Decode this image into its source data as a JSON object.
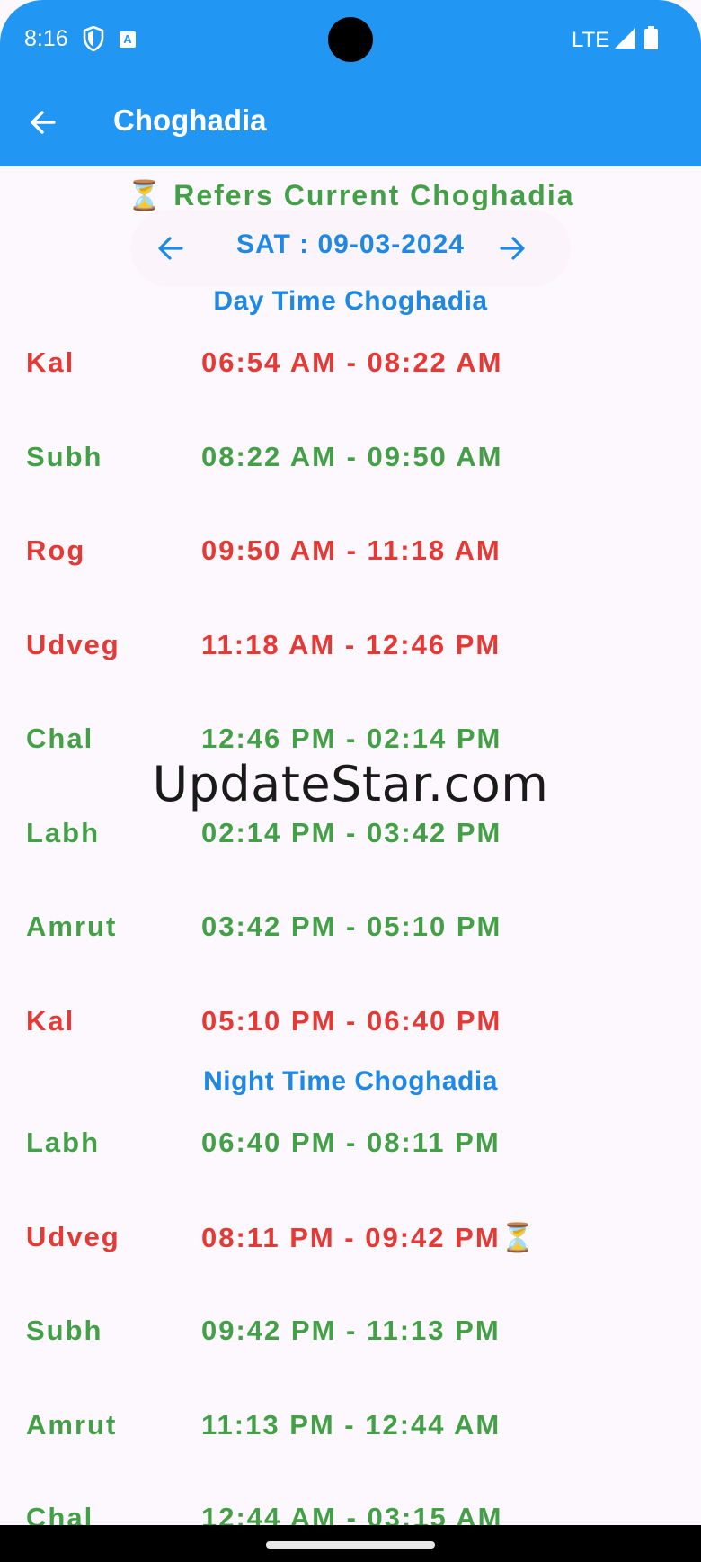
{
  "status_bar": {
    "time": "8:16",
    "network": "LTE"
  },
  "app_bar": {
    "title": "Choghadia"
  },
  "legend": {
    "icon": "⏳",
    "text": "Refers Current Choghadia"
  },
  "date_nav": {
    "label": "SAT : 09-03-2024"
  },
  "day_section": {
    "title": "Day Time Choghadia",
    "rows": [
      {
        "name": "Kal",
        "time": "06:54 AM - 08:22 AM",
        "color": "#e53935"
      },
      {
        "name": "Subh",
        "time": "08:22 AM - 09:50 AM",
        "color": "#43a047"
      },
      {
        "name": "Rog",
        "time": "09:50 AM - 11:18 AM",
        "color": "#e53935"
      },
      {
        "name": "Udveg",
        "time": "11:18 AM - 12:46 PM",
        "color": "#e53935"
      },
      {
        "name": "Chal",
        "time": "12:46 PM - 02:14 PM",
        "color": "#43a047"
      },
      {
        "name": "Labh",
        "time": "02:14 PM - 03:42 PM",
        "color": "#43a047"
      },
      {
        "name": "Amrut",
        "time": "03:42 PM - 05:10 PM",
        "color": "#43a047"
      },
      {
        "name": "Kal",
        "time": "05:10 PM - 06:40 PM",
        "color": "#e53935"
      }
    ]
  },
  "night_section": {
    "title": "Night Time Choghadia",
    "rows": [
      {
        "name": "Labh",
        "time": "06:40 PM - 08:11 PM",
        "color": "#43a047"
      },
      {
        "name": "Udveg",
        "time": "08:11 PM - 09:42 PM⏳",
        "color": "#e53935"
      },
      {
        "name": "Subh",
        "time": "09:42 PM - 11:13 PM",
        "color": "#43a047"
      },
      {
        "name": "Amrut",
        "time": "11:13 PM - 12:44 AM",
        "color": "#43a047"
      },
      {
        "name": "Chal",
        "time": "12:44 AM - 03:15 AM",
        "color": "#43a047"
      }
    ]
  },
  "watermark": "UpdateStar.com",
  "colors": {
    "accent": "#2196f3",
    "auspicious": "#43a047",
    "inauspicious": "#e53935",
    "heading": "#1e88e5"
  }
}
